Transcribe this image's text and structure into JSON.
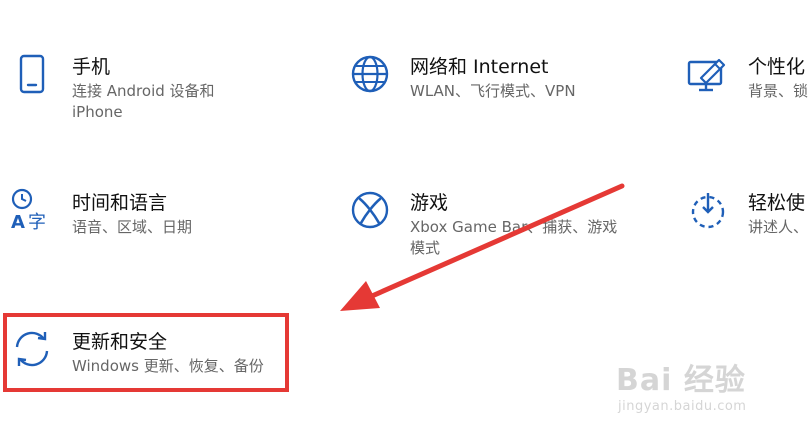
{
  "colors": {
    "icon_blue": "#1f5fb8",
    "annotation_red": "#e53935",
    "title_text": "#111111",
    "desc_text": "#666666"
  },
  "tiles": [
    {
      "title": "手机",
      "desc": "连接 Android 设备和 iPhone",
      "icon": "phone-icon"
    },
    {
      "title": "网络和 Internet",
      "desc": "WLAN、飞行模式、VPN",
      "icon": "globe-icon"
    },
    {
      "title": "个性化",
      "desc": "背景、锁",
      "icon": "personalization-icon"
    },
    {
      "title": "时间和语言",
      "desc": "语音、区域、日期",
      "icon": "time-language-icon"
    },
    {
      "title": "游戏",
      "desc": "Xbox Game Bar、捕获、游戏模式",
      "icon": "xbox-icon"
    },
    {
      "title": "轻松使",
      "desc": "讲述人、",
      "icon": "ease-of-access-icon"
    },
    {
      "title": "更新和安全",
      "desc": "Windows 更新、恢复、备份",
      "icon": "sync-icon"
    }
  ],
  "watermark": {
    "line1": "Bai 经验",
    "line2": "jingyan.baidu.com"
  }
}
